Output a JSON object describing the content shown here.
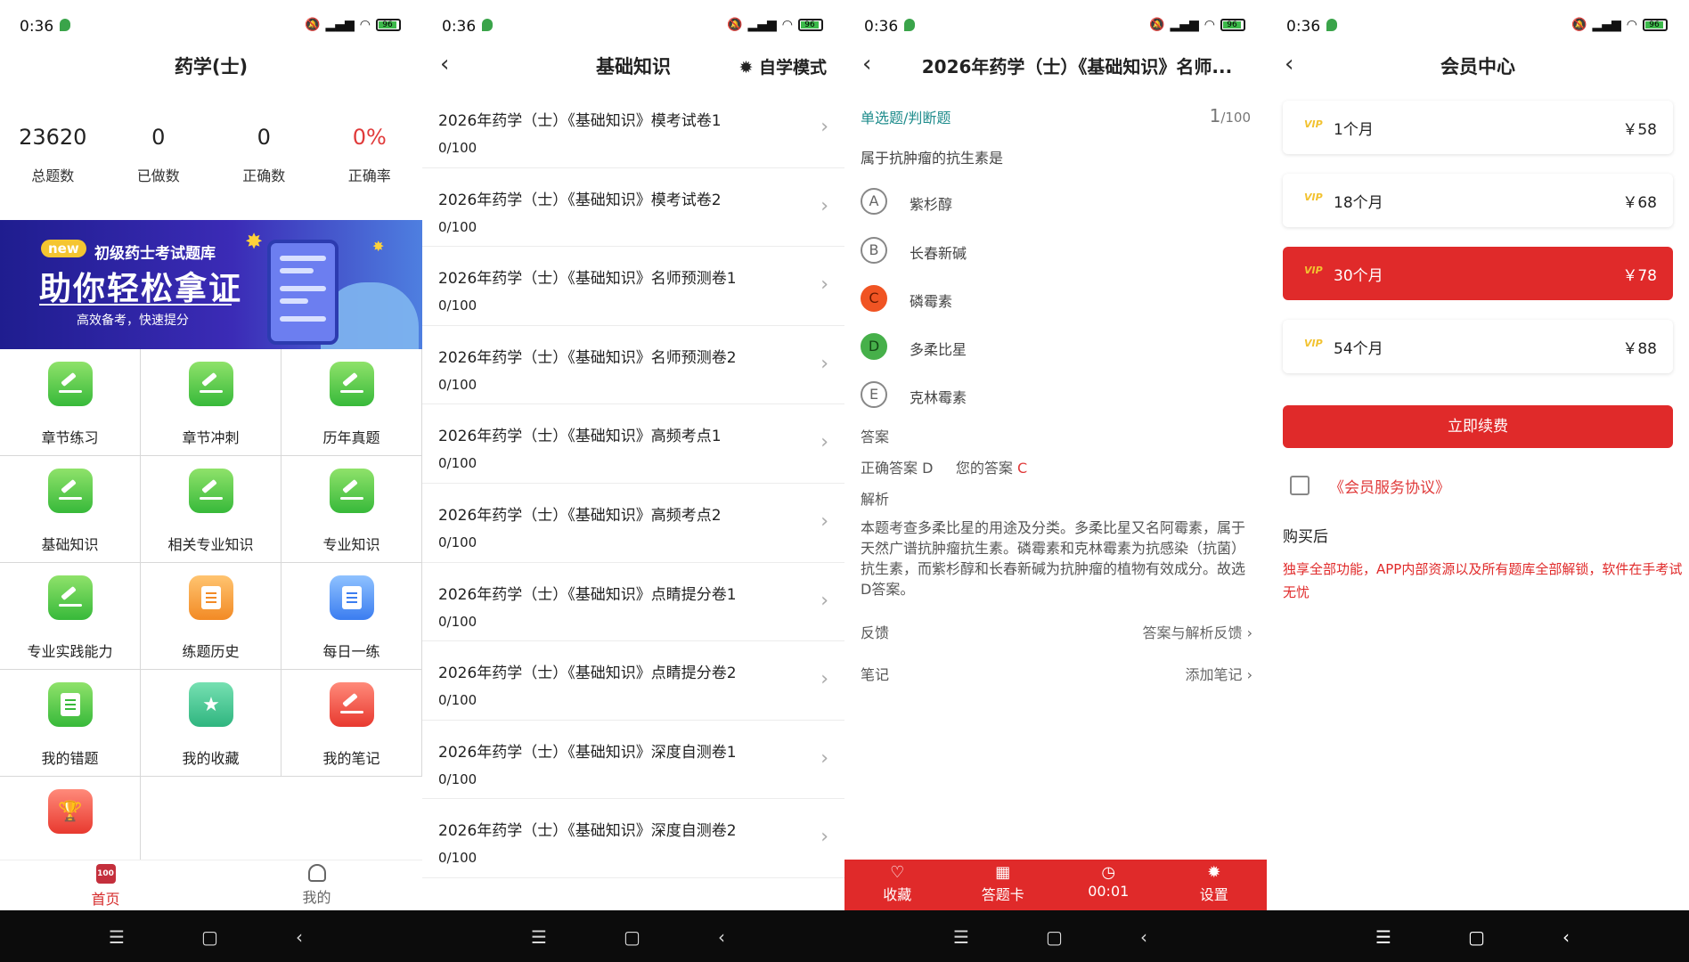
{
  "status": {
    "time": "0:36",
    "battery": "96"
  },
  "screen1": {
    "title": "药学(士)",
    "stats": [
      {
        "value": "23620",
        "label": "总题数"
      },
      {
        "value": "0",
        "label": "已做数"
      },
      {
        "value": "0",
        "label": "正确数"
      },
      {
        "value": "0%",
        "label": "正确率"
      }
    ],
    "banner": {
      "badge": "new",
      "line1": "初级药士考试题库",
      "headline": "助你轻松拿证",
      "line2": "高效备考，快速提分"
    },
    "grid": [
      {
        "label": "章节练习",
        "icon": "pencil-icon",
        "color": "green"
      },
      {
        "label": "章节冲刺",
        "icon": "pencil-icon",
        "color": "green"
      },
      {
        "label": "历年真题",
        "icon": "pencil-icon",
        "color": "green"
      },
      {
        "label": "基础知识",
        "icon": "pencil-icon",
        "color": "green"
      },
      {
        "label": "相关专业知识",
        "icon": "pencil-icon",
        "color": "green"
      },
      {
        "label": "专业知识",
        "icon": "pencil-icon",
        "color": "green"
      },
      {
        "label": "专业实践能力",
        "icon": "pencil-icon",
        "color": "green"
      },
      {
        "label": "练题历史",
        "icon": "history-icon",
        "color": "orange"
      },
      {
        "label": "每日一练",
        "icon": "document-icon",
        "color": "blue"
      },
      {
        "label": "我的错题",
        "icon": "wrong-book-icon",
        "color": "green"
      },
      {
        "label": "我的收藏",
        "icon": "favorite-folder-icon",
        "color": "teal"
      },
      {
        "label": "我的笔记",
        "icon": "note-icon",
        "color": "red"
      }
    ],
    "tabs": [
      {
        "label": "首页",
        "icon_text": "100"
      },
      {
        "label": "我的"
      }
    ]
  },
  "screen2": {
    "title": "基础知识",
    "mode": "自学模式",
    "items": [
      {
        "title": "2026年药学（士）《基础知识》模考试卷1",
        "progress": "0/100"
      },
      {
        "title": "2026年药学（士）《基础知识》模考试卷2",
        "progress": "0/100"
      },
      {
        "title": "2026年药学（士）《基础知识》名师预测卷1",
        "progress": "0/100"
      },
      {
        "title": "2026年药学（士）《基础知识》名师预测卷2",
        "progress": "0/100"
      },
      {
        "title": "2026年药学（士）《基础知识》高频考点1",
        "progress": "0/100"
      },
      {
        "title": "2026年药学（士）《基础知识》高频考点2",
        "progress": "0/100"
      },
      {
        "title": "2026年药学（士）《基础知识》点睛提分卷1",
        "progress": "0/100"
      },
      {
        "title": "2026年药学（士）《基础知识》点睛提分卷2",
        "progress": "0/100"
      },
      {
        "title": "2026年药学（士）《基础知识》深度自测卷1",
        "progress": "0/100"
      },
      {
        "title": "2026年药学（士）《基础知识》深度自测卷2",
        "progress": "0/100"
      }
    ]
  },
  "screen3": {
    "title": "2026年药学（士）《基础知识》名师...",
    "qtype": "单选题/判断题",
    "qindex": "1",
    "qtotal": "/100",
    "question": "属于抗肿瘤的抗生素是",
    "options": [
      {
        "key": "A",
        "text": "紫杉醇"
      },
      {
        "key": "B",
        "text": "长春新碱"
      },
      {
        "key": "C",
        "text": "磷霉素"
      },
      {
        "key": "D",
        "text": "多柔比星"
      },
      {
        "key": "E",
        "text": "克林霉素"
      }
    ],
    "answer_label": "答案",
    "correct_label": "正确答案 D",
    "yours_label": "您的答案",
    "yours_value": "C",
    "analysis_label": "解析",
    "analysis": "本题考查多柔比星的用途及分类。多柔比星又名阿霉素，属于天然广谱抗肿瘤抗生素。磷霉素和克林霉素为抗感染（抗菌）抗生素，而紫杉醇和长春新碱为抗肿瘤的植物有效成分。故选D答案。",
    "feedback_label": "反馈",
    "feedback_link": "答案与解析反馈",
    "note_label": "笔记",
    "note_link": "添加笔记",
    "bottom": [
      {
        "label": "收藏",
        "icon": "heart-icon"
      },
      {
        "label": "答题卡",
        "icon": "grid-icon"
      },
      {
        "label": "00:01",
        "icon": "clock-icon"
      },
      {
        "label": "设置",
        "icon": "gear-icon"
      }
    ],
    "colors": {
      "accent": "#e02a2a",
      "wrong": "#f05423",
      "right": "#46b04a"
    }
  },
  "screen4": {
    "title": "会员中心",
    "vip_tag": "VIP",
    "plans": [
      {
        "name": "1个月",
        "price": "￥58"
      },
      {
        "name": "18个月",
        "price": "￥68"
      },
      {
        "name": "30个月",
        "price": "￥78"
      },
      {
        "name": "54个月",
        "price": "￥88"
      }
    ],
    "renew": "立即续费",
    "agreement": "《会员服务协议》",
    "after_title": "购买后",
    "benefit": "独享全部功能，APP内部资源以及所有题库全部解锁，软件在手考试无忧"
  }
}
